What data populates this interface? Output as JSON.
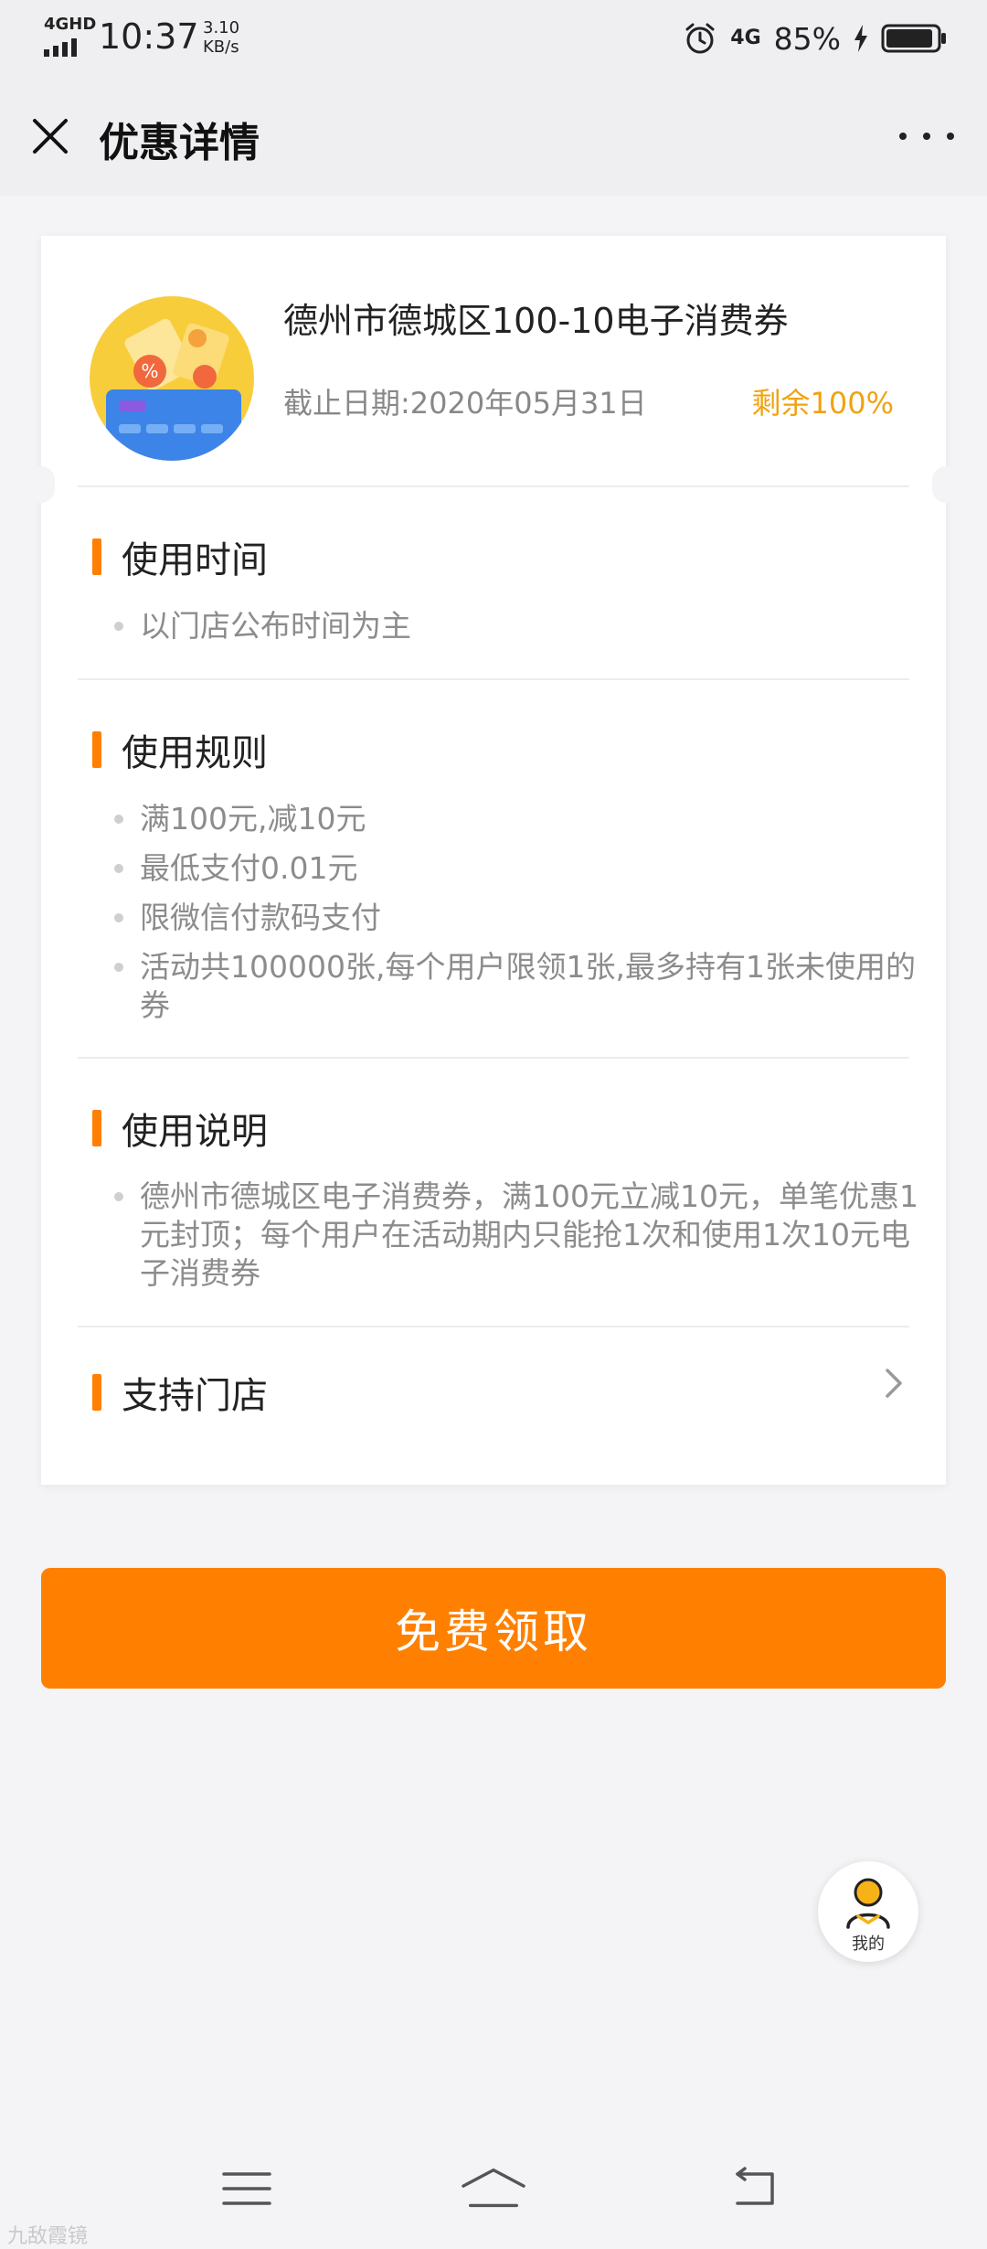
{
  "status_bar": {
    "network_label": "4GHD",
    "time": "10:37",
    "speed_value": "3.10",
    "speed_unit": "KB/s",
    "network_right": "4G",
    "battery": "85%"
  },
  "header": {
    "title": "优惠详情",
    "close_icon": "close-icon",
    "more_icon": "more-icon"
  },
  "coupon": {
    "title": "德州市德城区100-10电子消费券",
    "expiry": "截止日期:2020年05月31日",
    "remaining": "剩余100%"
  },
  "sections": {
    "time": {
      "title": "使用时间",
      "items": [
        "以门店公布时间为主"
      ]
    },
    "rules": {
      "title": "使用规则",
      "items": [
        "满100元,减10元",
        "最低支付0.01元",
        "限微信付款码支付",
        "活动共100000张,每个用户限领1张,最多持有1张未使用的券"
      ]
    },
    "description": {
      "title": "使用说明",
      "items": [
        "德州市德城区电子消费券，满100元立减10元，单笔优惠1元封顶；每个用户在活动期内只能抢1次和使用1次10元电子消费券"
      ]
    },
    "stores": {
      "title": "支持门店"
    }
  },
  "claim_button": "免费领取",
  "fab": {
    "label": "我的"
  },
  "watermark": "九敌霞镜",
  "colors": {
    "accent": "#ff8000",
    "remaining": "#f0a30f",
    "icon_bg": "#f8cd3c",
    "card_blue": "#3d84e8"
  }
}
